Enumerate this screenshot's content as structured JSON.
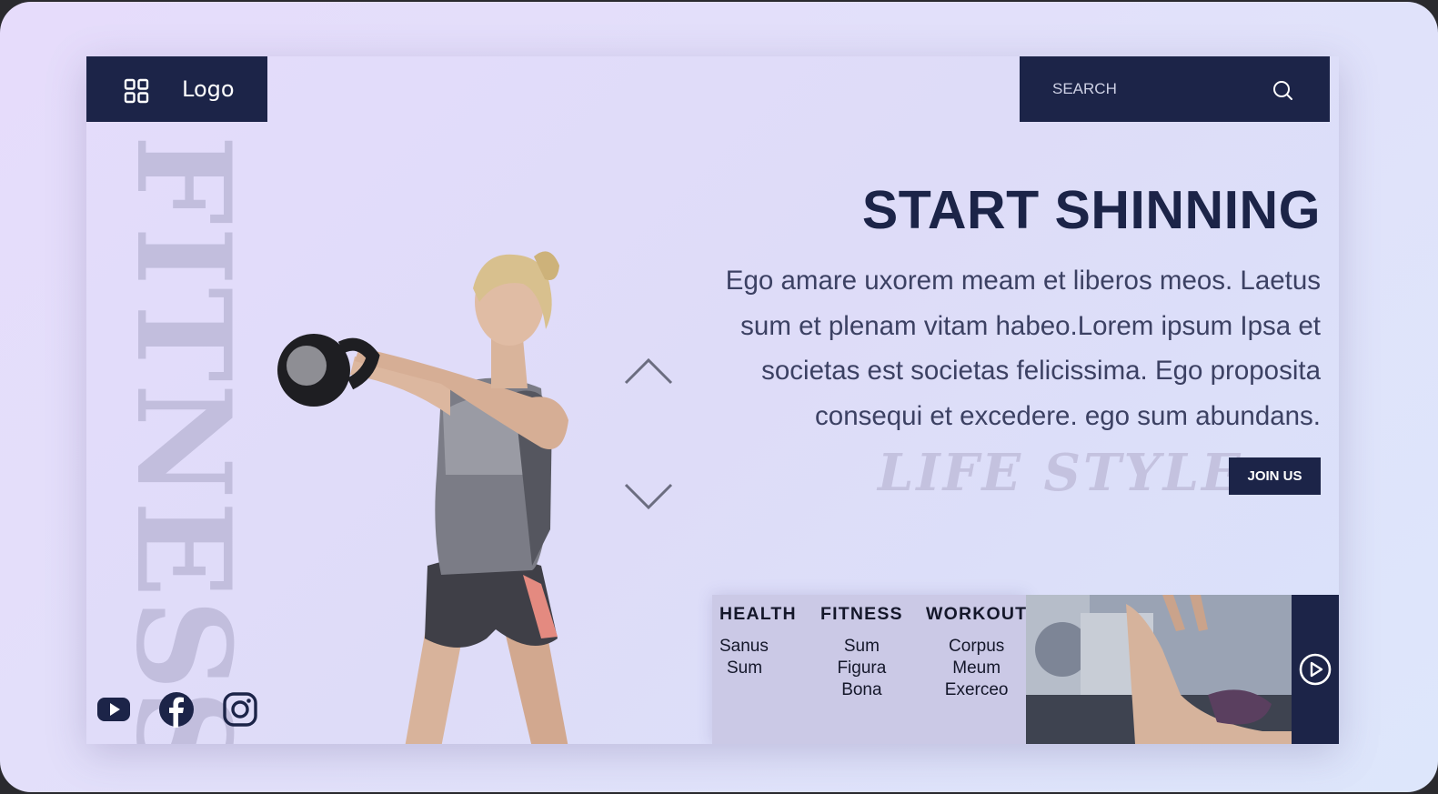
{
  "header": {
    "logo_label": "Logo",
    "grid_icon": "grid-icon",
    "search_placeholder": "SEARCH",
    "search_icon": "search-icon"
  },
  "watermark": {
    "vertical": "FITNESS",
    "lifestyle": "LIFE STYLE"
  },
  "hero": {
    "headline": "START SHINNING",
    "body": "Ego amare uxorem meam et liberos meos. Laetus sum et plenam vitam habeo.Lorem ipsum Ipsa et societas est societas felicissima. Ego proposita consequi et excedere. ego sum abundans.",
    "join_label": "JOIN US"
  },
  "slider": {
    "up_icon": "chevron-up-icon",
    "down_icon": "chevron-down-icon"
  },
  "categories": [
    {
      "title": "HEALTH",
      "items": [
        "Sanus",
        "Sum"
      ]
    },
    {
      "title": "FITNESS",
      "items": [
        "Sum",
        "Figura",
        "Bona"
      ]
    },
    {
      "title": "WORKOUT",
      "items": [
        "Corpus",
        "Meum",
        "Exerceo"
      ]
    }
  ],
  "video": {
    "play_icon": "play-circle-icon"
  },
  "social": [
    "youtube-icon",
    "facebook-icon",
    "instagram-icon"
  ],
  "colors": {
    "navy": "#1c2448",
    "background": "#e2dffa",
    "watermark": "#c2bedd"
  }
}
